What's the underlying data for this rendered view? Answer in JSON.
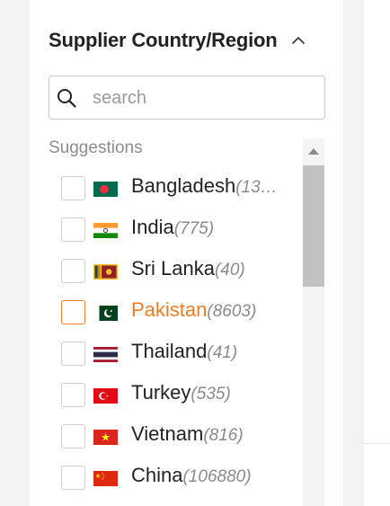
{
  "filter": {
    "title": "Supplier Country/Region",
    "collapse_icon": "chevron-up-icon",
    "search_placeholder": "search",
    "search_value": "",
    "section_label": "Suggestions"
  },
  "colors": {
    "accent": "#f07c22",
    "text": "#222222",
    "muted": "#8a8a8a",
    "checkbox_border": "#cfcfcf"
  },
  "countries": [
    {
      "name": "Bangladesh",
      "count": "(13…",
      "flag": "bangladesh-flag-icon",
      "active": false
    },
    {
      "name": "India",
      "count": "(775)",
      "flag": "india-flag-icon",
      "active": false
    },
    {
      "name": "Sri Lanka",
      "count": "(40)",
      "flag": "sri-lanka-flag-icon",
      "active": false
    },
    {
      "name": "Pakistan",
      "count": "(8603)",
      "flag": "pakistan-flag-icon",
      "active": true
    },
    {
      "name": "Thailand",
      "count": "(41)",
      "flag": "thailand-flag-icon",
      "active": false
    },
    {
      "name": "Turkey",
      "count": "(535)",
      "flag": "turkey-flag-icon",
      "active": false
    },
    {
      "name": "Vietnam",
      "count": "(816)",
      "flag": "vietnam-flag-icon",
      "active": false
    },
    {
      "name": "China",
      "count": "(106880)",
      "flag": "china-flag-icon",
      "active": false
    }
  ]
}
